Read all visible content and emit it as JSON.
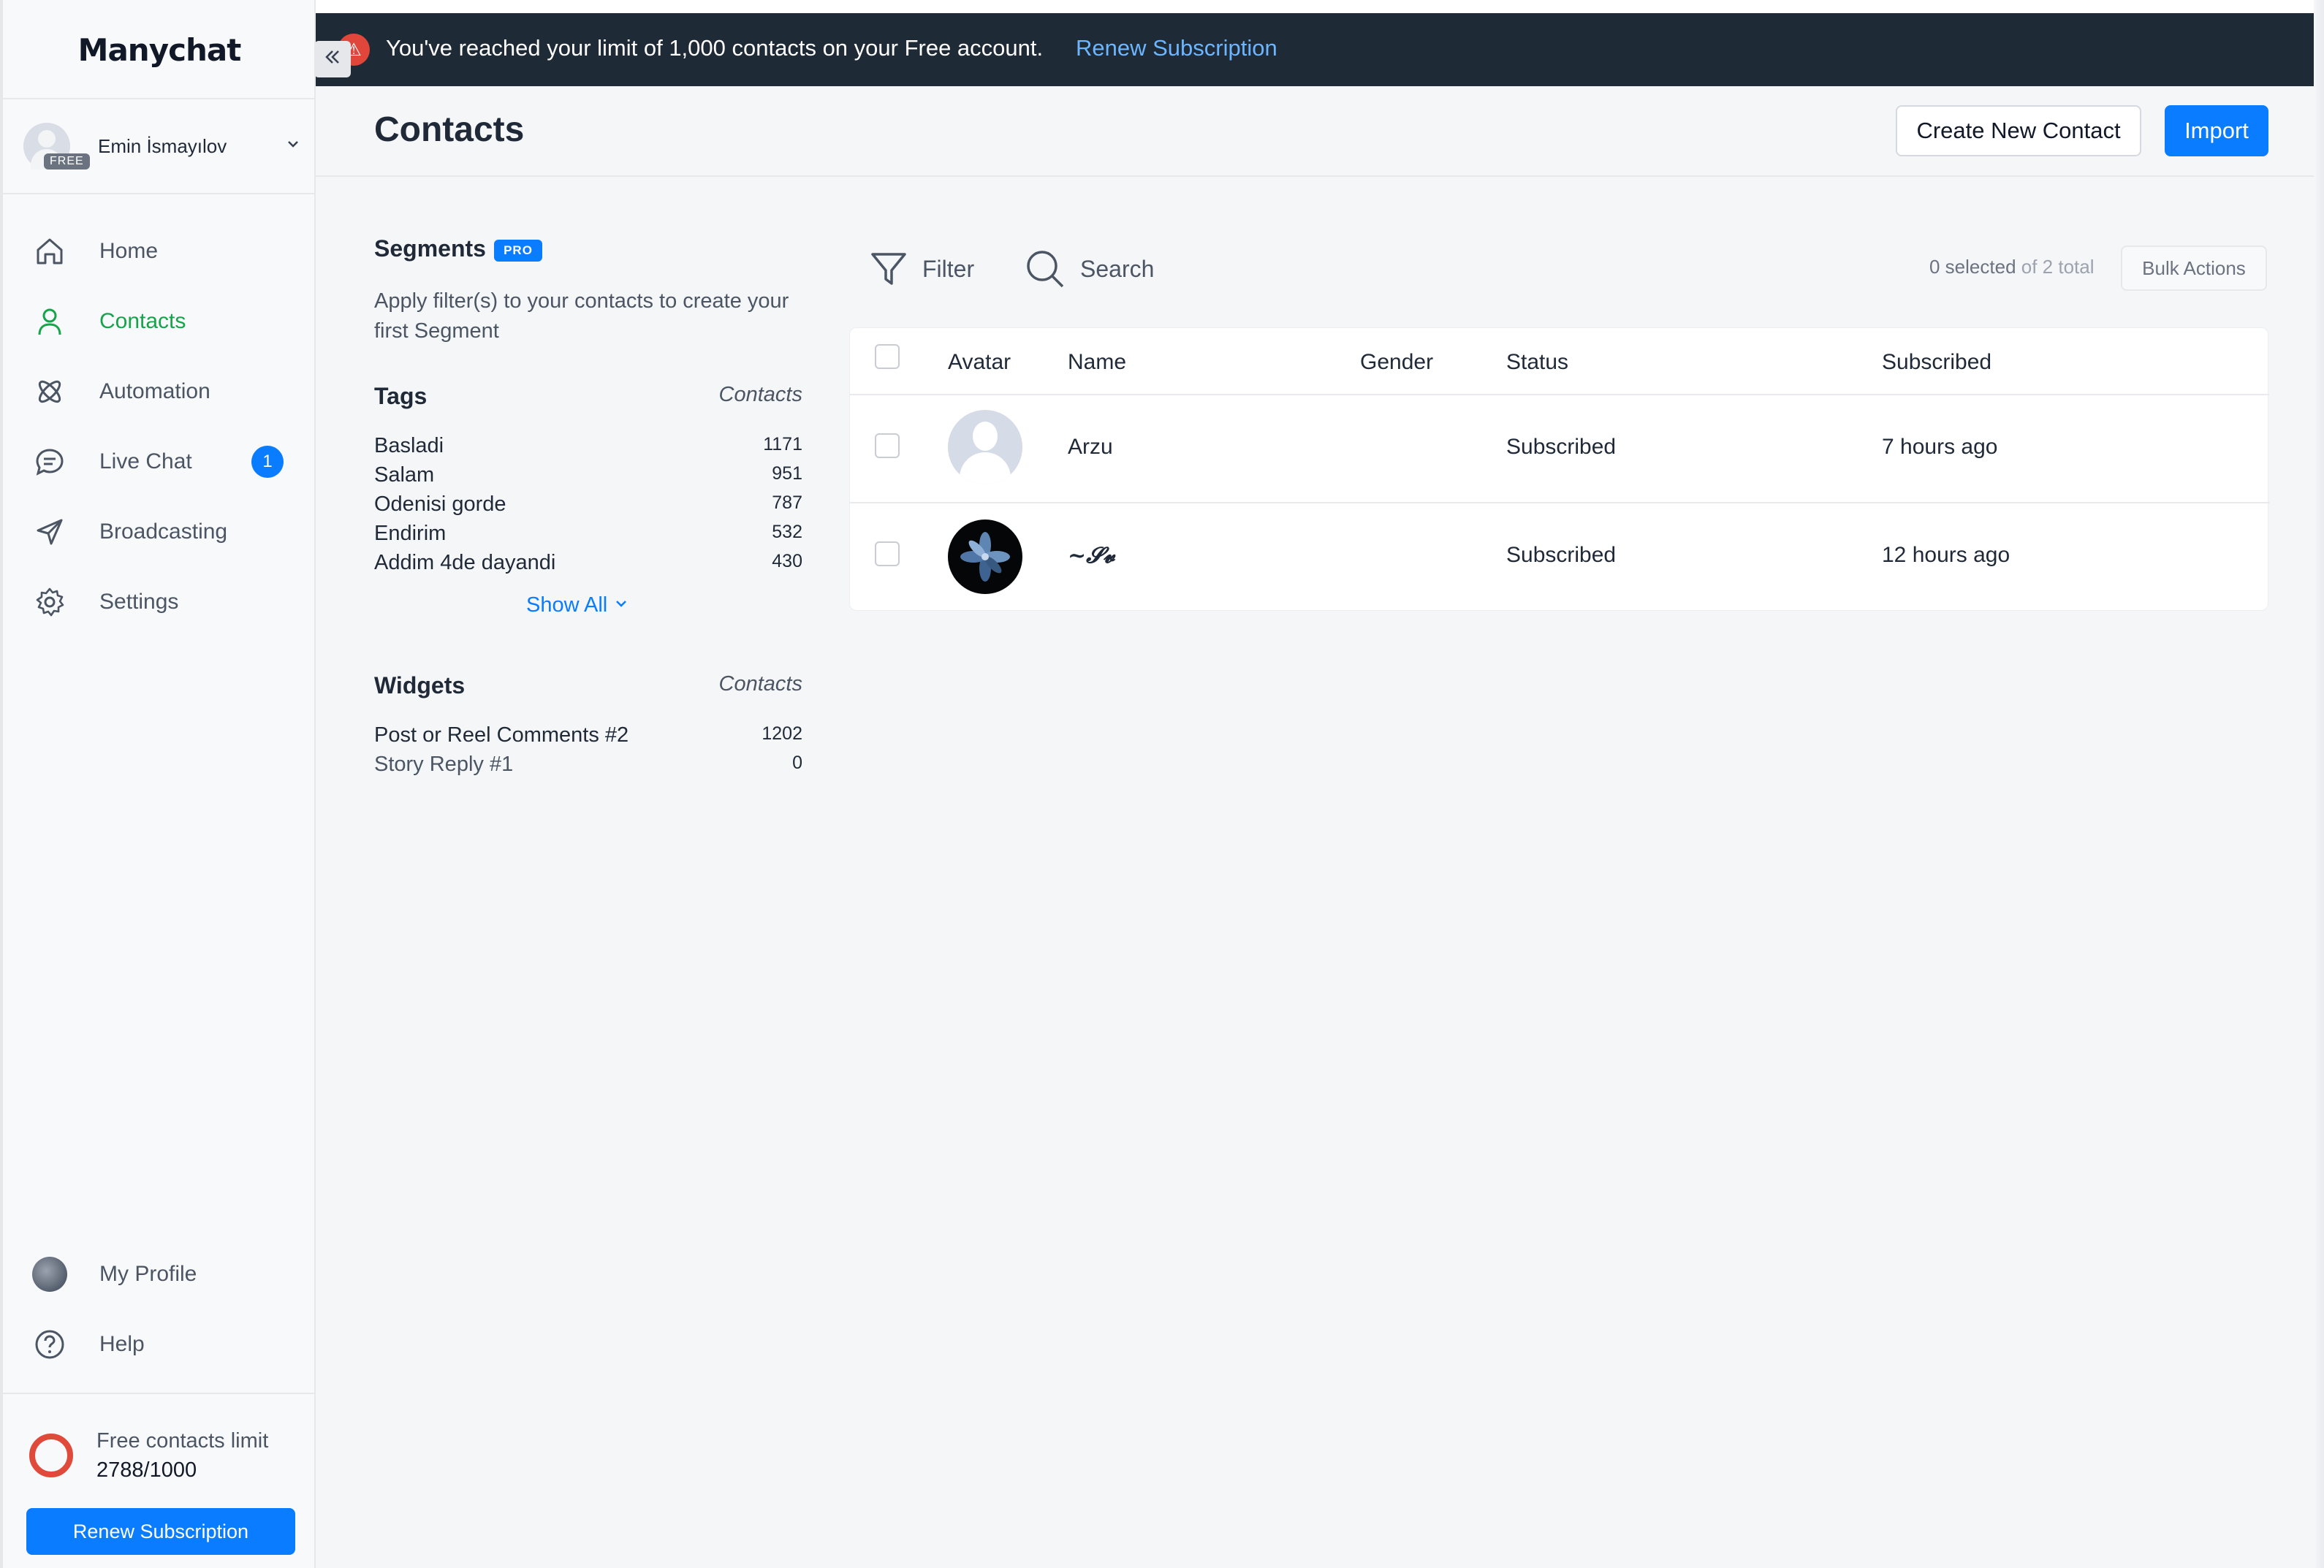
{
  "app": {
    "logo": "Manychat"
  },
  "account": {
    "name": "Emin İsmayılov",
    "plan_badge": "FREE"
  },
  "nav": {
    "items": [
      {
        "label": "Home",
        "icon": "home-icon"
      },
      {
        "label": "Contacts",
        "icon": "user-icon",
        "active": true
      },
      {
        "label": "Automation",
        "icon": "automation-icon"
      },
      {
        "label": "Live Chat",
        "icon": "chat-icon",
        "badge": "1"
      },
      {
        "label": "Broadcasting",
        "icon": "send-icon"
      },
      {
        "label": "Settings",
        "icon": "gear-icon"
      }
    ],
    "bottom": [
      {
        "label": "My Profile",
        "icon": "profile-photo"
      },
      {
        "label": "Help",
        "icon": "help-icon"
      }
    ]
  },
  "limit": {
    "label": "Free contacts limit",
    "value": "2788/1000",
    "renew_label": "Renew Subscription"
  },
  "banner": {
    "text": "You've reached your limit of 1,000 contacts on your Free account.",
    "link": "Renew Subscription"
  },
  "page": {
    "title": "Contacts",
    "create_button": "Create New Contact",
    "import_button": "Import"
  },
  "segments": {
    "title": "Segments",
    "badge": "PRO",
    "description": "Apply filter(s) to your contacts to create your first Segment"
  },
  "tags": {
    "title": "Tags",
    "column_label": "Contacts",
    "items": [
      {
        "name": "Basladi",
        "count": "1171"
      },
      {
        "name": "Salam",
        "count": "951"
      },
      {
        "name": "Odenisi gorde",
        "count": "787"
      },
      {
        "name": "Endirim",
        "count": "532"
      },
      {
        "name": "Addim 4de dayandi",
        "count": "430"
      }
    ],
    "show_all": "Show All"
  },
  "widgets": {
    "title": "Widgets",
    "column_label": "Contacts",
    "items": [
      {
        "name": "Post or Reel Comments #2",
        "count": "1202"
      },
      {
        "name": "Story Reply #1",
        "count": "0"
      }
    ]
  },
  "toolbar": {
    "filter": "Filter",
    "search": "Search",
    "selected": "0 selected",
    "total": "of 2 total",
    "bulk_actions": "Bulk Actions"
  },
  "table": {
    "headers": {
      "avatar": "Avatar",
      "name": "Name",
      "gender": "Gender",
      "status": "Status",
      "subscribed": "Subscribed"
    },
    "rows": [
      {
        "name": "Arzu",
        "gender": "",
        "status": "Subscribed",
        "subscribed": "7 hours ago"
      },
      {
        "name": "~𝓢𝓿",
        "gender": "",
        "status": "Subscribed",
        "subscribed": "12 hours ago"
      }
    ]
  },
  "colors": {
    "accent": "#0a7cff",
    "active_nav": "#16a34a",
    "banner_bg": "#1f2a37",
    "warning": "#e0473a"
  }
}
